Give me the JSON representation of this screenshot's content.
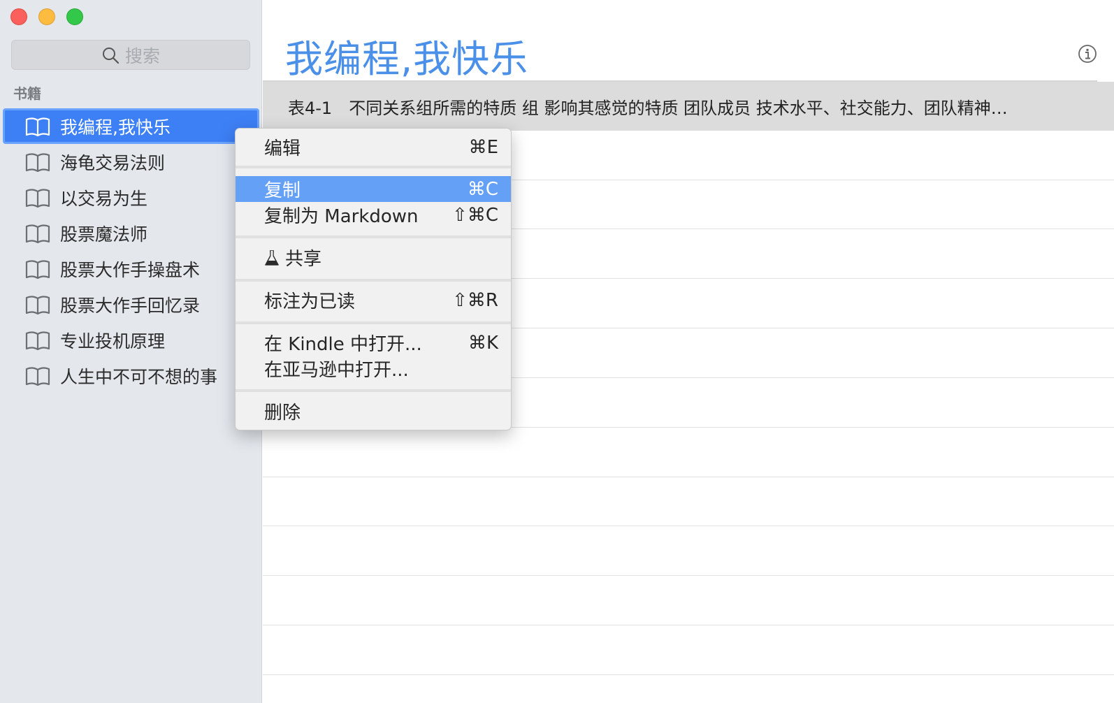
{
  "sidebar": {
    "search_placeholder": "搜索",
    "section_label": "书籍",
    "books": [
      {
        "title": "我编程,我快乐",
        "selected": true
      },
      {
        "title": "海龟交易法则"
      },
      {
        "title": "以交易为生"
      },
      {
        "title": "股票魔法师"
      },
      {
        "title": "股票大作手操盘术"
      },
      {
        "title": "股票大作手回忆录"
      },
      {
        "title": "专业投机原理"
      },
      {
        "title": "人生中不可不想的事"
      }
    ]
  },
  "main": {
    "title": "我编程,我快乐",
    "highlight_text": "表4-1　不同关系组所需的特质 组 影响其感觉的特质 团队成员 技术水平、社交能力、团队精神…"
  },
  "context_menu": {
    "items": [
      {
        "label": "编辑",
        "shortcut": "⌘E"
      },
      {
        "label": "复制",
        "shortcut": "⌘C",
        "active": true
      },
      {
        "label": "复制为 Markdown",
        "shortcut": "⇧⌘C"
      },
      {
        "label": "共享",
        "shortcut": ""
      },
      {
        "label": "标注为已读",
        "shortcut": "⇧⌘R"
      },
      {
        "label": "在 Kindle 中打开...",
        "shortcut": "⌘K"
      },
      {
        "label": "在亚马逊中打开...",
        "shortcut": ""
      },
      {
        "label": "删除",
        "shortcut": ""
      }
    ]
  },
  "colors": {
    "accent": "#3d7ff5",
    "title_blue": "#4a8fe8",
    "menu_highlight": "#65a0f7"
  },
  "icons": {
    "search": "magnifier-icon",
    "book": "open-book-icon",
    "info": "info-circle-icon",
    "share": "flask-icon"
  }
}
